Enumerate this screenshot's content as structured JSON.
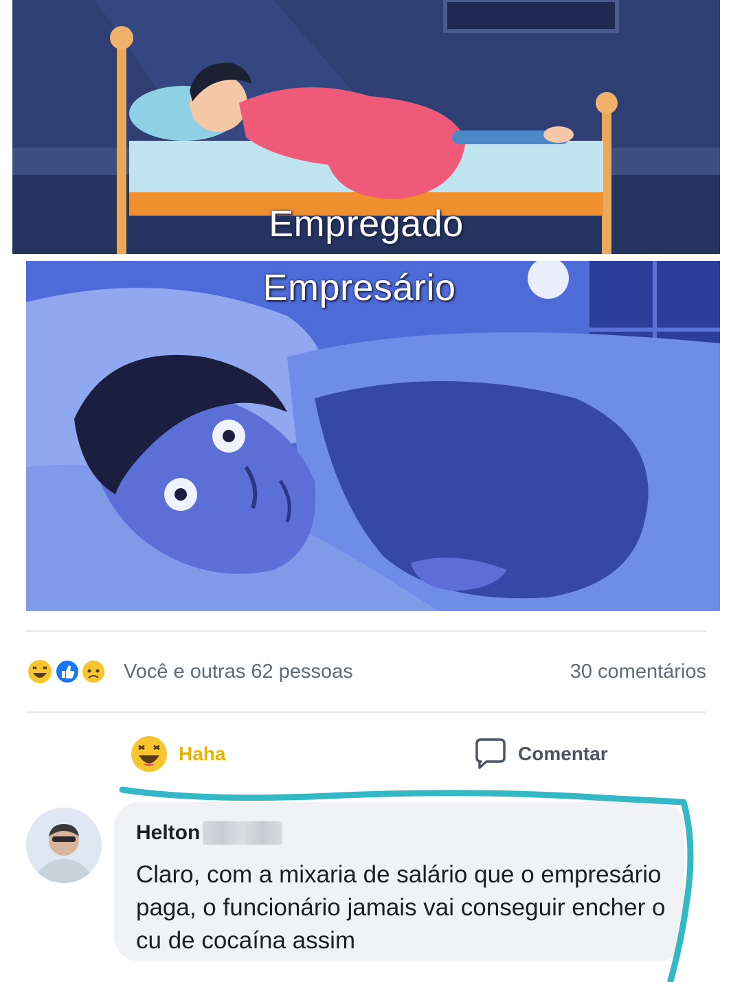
{
  "meme": {
    "top_caption": "Empregado",
    "bottom_caption": "Empresário"
  },
  "post": {
    "reaction_icons": [
      "haha-icon",
      "like-icon",
      "sad-icon"
    ],
    "reaction_summary": "Você e outras 62 pessoas",
    "comments_count": "30 comentários",
    "actions": {
      "haha_label": "Haha",
      "comment_label": "Comentar"
    }
  },
  "comment": {
    "author": "Helton",
    "text": "Claro, com a mixaria de salário que o empresário paga, o funcionário jamais vai conseguir encher o cu de cocaína assim"
  },
  "colors": {
    "haha_yellow": "#f7c52e",
    "annotation_stroke": "#35b8c6",
    "reaction_text": "#5f6b7a"
  }
}
